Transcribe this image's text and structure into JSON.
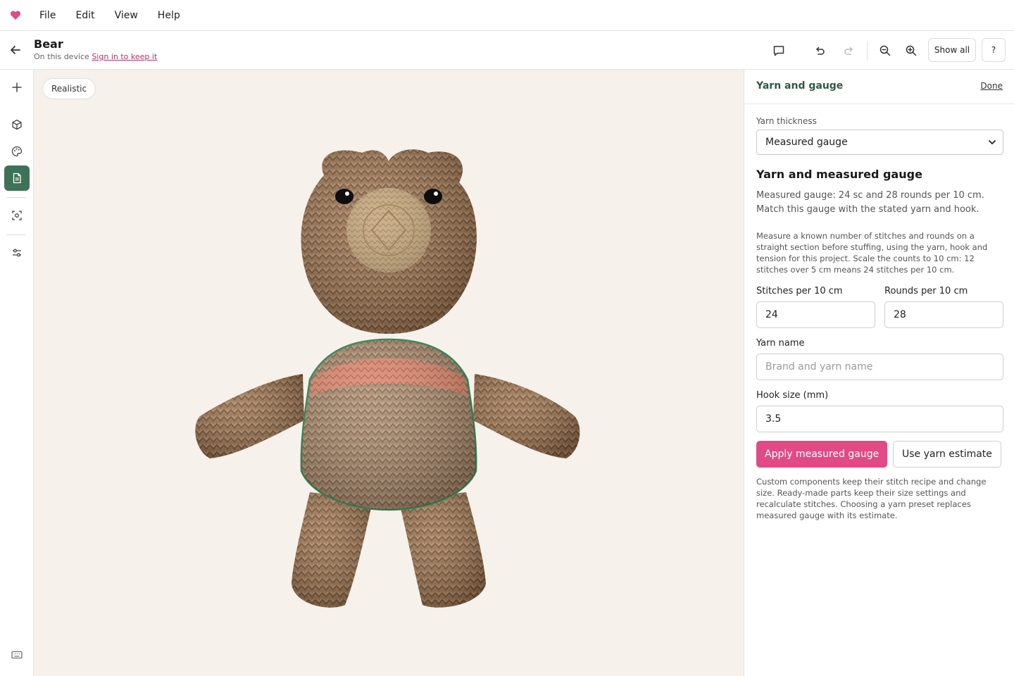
{
  "menubar": {
    "logo_icon": "heart-icon",
    "items": [
      "File",
      "Edit",
      "View",
      "Help"
    ]
  },
  "header": {
    "title": "Bear",
    "subtitle_prefix": "On this device",
    "sign_in_link": "Sign in to keep it",
    "show_all_label": "Show all",
    "help_label": "?"
  },
  "viewport": {
    "render_mode": "Realistic"
  },
  "left_rail": {
    "icons": [
      "plus-icon",
      "cube-icon",
      "palette-icon",
      "document-icon",
      "focus-icon",
      "sliders-icon",
      "keyboard-icon"
    ],
    "active": "document-icon",
    "accent": "#3e7257"
  },
  "panel": {
    "title": "Yarn and gauge",
    "done_label": "Done",
    "yarn_thickness_label": "Yarn thickness",
    "yarn_thickness_value": "Measured gauge",
    "section_heading": "Yarn and measured gauge",
    "summary": "Measured gauge: 24 sc and 28 rounds per 10 cm. Match this gauge with the stated yarn and hook.",
    "instructions": "Measure a known number of stitches and rounds on a straight section before stuffing, using the yarn, hook and tension for this project. Scale the counts to 10 cm: 12 stitches over 5 cm means 24 stitches per 10 cm.",
    "stitches_label": "Stitches per 10 cm",
    "stitches_value": "24",
    "rounds_label": "Rounds per 10 cm",
    "rounds_value": "28",
    "yarn_name_label": "Yarn name",
    "yarn_name_placeholder": "Brand and yarn name",
    "hook_label": "Hook size (mm)",
    "hook_value": "3.5",
    "apply_label": "Apply measured gauge",
    "estimate_label": "Use yarn estimate",
    "footnote": "Custom components keep their stitch recipe and change size. Ready-made parts keep their size settings and recalculate stitches. Choosing a yarn preset replaces measured gauge with its estimate."
  },
  "colors": {
    "brand_pink": "#e14a85",
    "title_green": "#2f5a44",
    "canvas_bg": "#f7f1eb",
    "bear_brown": "#9b7451",
    "muzzle_tan": "#c9ad85",
    "stripe_coral": "#e18a70",
    "selection_green": "#3a8a5a"
  }
}
